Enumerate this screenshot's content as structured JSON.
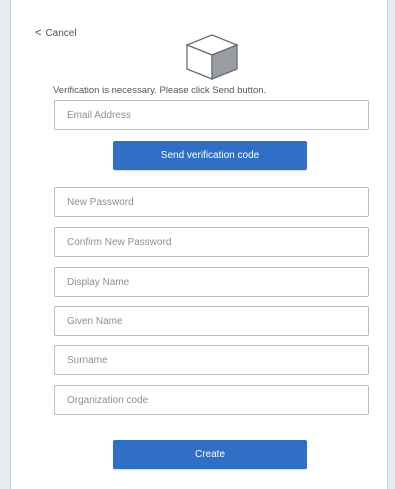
{
  "header": {
    "cancel_label": "Cancel"
  },
  "logo": {
    "icon": "cube-icon"
  },
  "verification": {
    "message": "Verification is necessary. Please click Send button.",
    "email_placeholder": "Email Address",
    "send_button_label": "Send verification code"
  },
  "form": {
    "new_password_placeholder": "New Password",
    "confirm_password_placeholder": "Confirm New Password",
    "display_name_placeholder": "Display Name",
    "given_name_placeholder": "Given Name",
    "surname_placeholder": "Surname",
    "organization_code_placeholder": "Organization code",
    "create_button_label": "Create"
  },
  "colors": {
    "primary_button": "#2f6fc6",
    "field_border": "#b8bcc1"
  }
}
